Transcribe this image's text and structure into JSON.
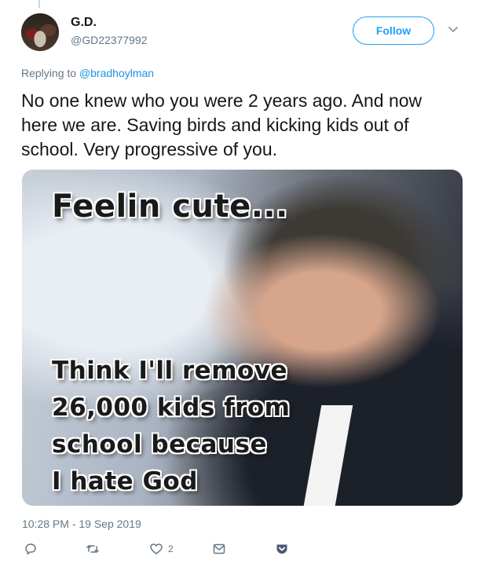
{
  "user": {
    "name": "G.D.",
    "handle": "@GD22377992",
    "follow_label": "Follow"
  },
  "tweet": {
    "reply_prefix": "Replying to",
    "reply_mention": "@bradhoylman",
    "text": "No one knew who you were 2 years ago. And now here we are. Saving birds and kicking kids out of school. Very progressive of you.",
    "timestamp": "10:28 PM - 19 Sep 2019",
    "likes": "2"
  },
  "media": {
    "top_text": "Feelin cute...",
    "bottom_lines": [
      "Think I'll remove",
      "26,000 kids from",
      "school because",
      "I hate God"
    ]
  },
  "icons": {
    "reply": "reply-icon",
    "retweet": "retweet-icon",
    "like": "heart-icon",
    "dm": "envelope-icon",
    "save": "pocket-save-icon"
  },
  "colors": {
    "accent": "#1da1f2",
    "mention": "#1b95e0",
    "secondary_text": "#657786",
    "save_icon": "#4a5a72"
  }
}
